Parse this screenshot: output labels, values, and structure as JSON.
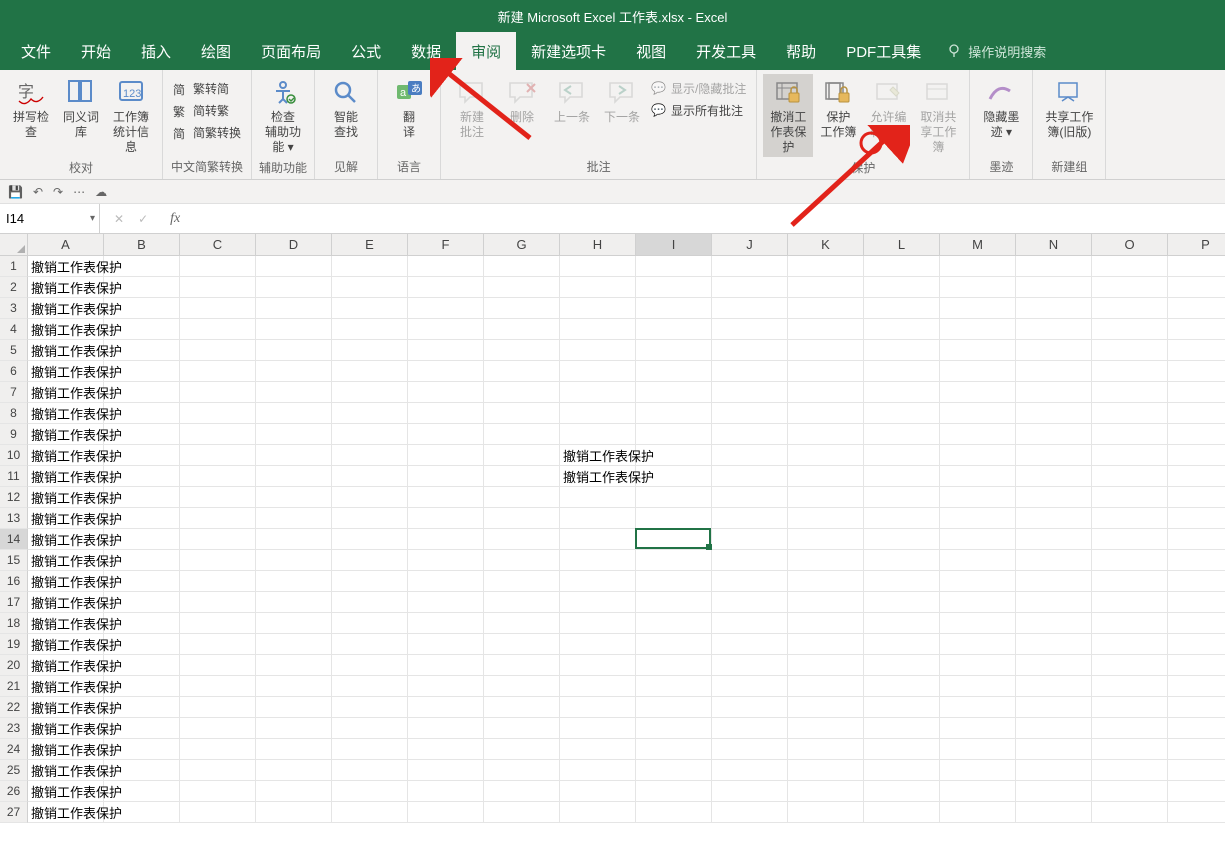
{
  "title": "新建 Microsoft Excel 工作表.xlsx  -  Excel",
  "tabs": [
    "文件",
    "开始",
    "插入",
    "绘图",
    "页面布局",
    "公式",
    "数据",
    "审阅",
    "新建选项卡",
    "视图",
    "开发工具",
    "帮助",
    "PDF工具集"
  ],
  "active_tab": "审阅",
  "search_placeholder": "操作说明搜索",
  "groups": {
    "proofing": {
      "label": "校对",
      "spell": {
        "l1": "拼写检查"
      },
      "thes": {
        "l1": "同义词库"
      },
      "stats": {
        "l1": "工作簿",
        "l2": "统计信息"
      }
    },
    "chinese": {
      "label": "中文简繁转换",
      "r1": "繁转简",
      "r2": "简转繁",
      "r3": "简繁转换"
    },
    "acc": {
      "label": "辅助功能",
      "btn": {
        "l1": "检查",
        "l2": "辅助功能"
      }
    },
    "insight": {
      "label": "见解",
      "btn": {
        "l1": "智能",
        "l2": "查找"
      }
    },
    "lang": {
      "label": "语言",
      "btn": {
        "l1": "翻",
        "l2": "译"
      }
    },
    "comments": {
      "label": "批注",
      "new": {
        "l1": "新建",
        "l2": "批注"
      },
      "del": {
        "l1": "删除"
      },
      "prev": {
        "l1": "上一条"
      },
      "next": {
        "l1": "下一条"
      },
      "show": "显示/隐藏批注",
      "showall": "显示所有批注"
    },
    "protect": {
      "label": "保护",
      "unprotect": {
        "l1": "撤消工",
        "l2": "作表保护"
      },
      "wb": {
        "l1": "保护",
        "l2": "工作簿"
      },
      "ranges": {
        "l1": "允许编",
        "l2": "辑区域"
      },
      "unshare": {
        "l1": "取消共",
        "l2": "享工作簿"
      }
    },
    "ink": {
      "label": "墨迹",
      "btn": {
        "l1": "隐藏墨",
        "l2": "迹"
      }
    },
    "newgrp": {
      "label": "新建组",
      "btn": {
        "l1": "共享工作",
        "l2": "簿(旧版)"
      }
    }
  },
  "namebox": "I14",
  "columns": [
    "A",
    "B",
    "C",
    "D",
    "E",
    "F",
    "G",
    "H",
    "I",
    "J",
    "K",
    "L",
    "M",
    "N",
    "O",
    "P"
  ],
  "selected_col_index": 8,
  "selected_row_index": 13,
  "row_count": 27,
  "cell_text": "撤销工作表保护",
  "rows_with_A": [
    1,
    2,
    3,
    4,
    5,
    6,
    7,
    8,
    9,
    10,
    11,
    12,
    13,
    14,
    15,
    16,
    17,
    18,
    19,
    20,
    21,
    22,
    23,
    24,
    25,
    26,
    27
  ],
  "h10": "撤销工作表保护",
  "h11": "撤销工作表保护"
}
